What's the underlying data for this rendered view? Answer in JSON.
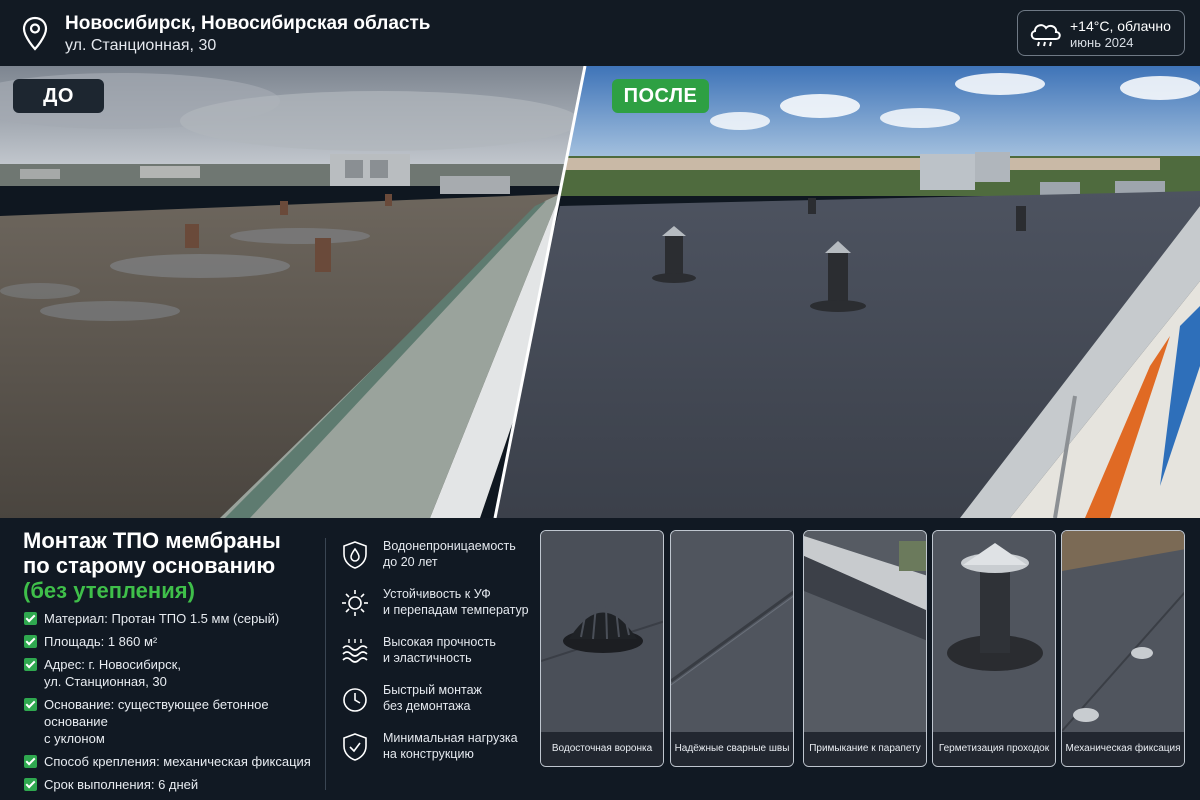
{
  "header": {
    "city": "Новосибирск, Новосибирская область",
    "street": "ул. Станционная, 30",
    "weather_line1": "+14°C, облачно",
    "weather_line2": "июнь 2024",
    "pin_icon": "map-pin-icon",
    "weather_icon": "rain-cloud-icon"
  },
  "photos": {
    "before_label": "ДО",
    "after_label": "ПОСЛЕ"
  },
  "project": {
    "title_line1": "Монтаж ТПО мембраны",
    "title_line2": "по старому основанию",
    "title_line3": "(без утепления)",
    "specs": [
      {
        "text": "Материал: Протан ТПО 1.5 мм (серый)"
      },
      {
        "text": "Площадь: 1 860 м²"
      },
      {
        "text": "Адрес: г. Новосибирск,",
        "text2": "ул. Станционная, 30"
      },
      {
        "text": "Основание: существующее бетонное основание",
        "text2": "с уклоном"
      },
      {
        "text": "Способ крепления: механическая фиксация"
      },
      {
        "text": "Срок выполнения: 6 дней"
      }
    ]
  },
  "features": [
    {
      "icon": "shield-drop-icon",
      "line1": "Водонепроницаемость",
      "line2": "до 20 лет"
    },
    {
      "icon": "sun-icon",
      "line1": "Устойчивость к УФ",
      "line2": "и перепадам температур"
    },
    {
      "icon": "waves-icon",
      "line1": "Высокая прочность",
      "line2": "и эластичность"
    },
    {
      "icon": "clock-icon",
      "line1": "Быстрый монтаж",
      "line2": "без демонтажа"
    },
    {
      "icon": "shield-check-icon",
      "line1": "Минимальная нагрузка",
      "line2": "на конструкцию"
    }
  ],
  "thumbnails": [
    {
      "caption": "Водосточная воронка"
    },
    {
      "caption": "Надёжные сварные швы"
    },
    {
      "caption": "Примыкание к парапету"
    },
    {
      "caption": "Герметизация проходок"
    },
    {
      "caption": "Механическая фиксация"
    }
  ],
  "colors": {
    "accent_green": "#2ea043",
    "title_green": "#3fbf4a",
    "background": "#111923"
  }
}
